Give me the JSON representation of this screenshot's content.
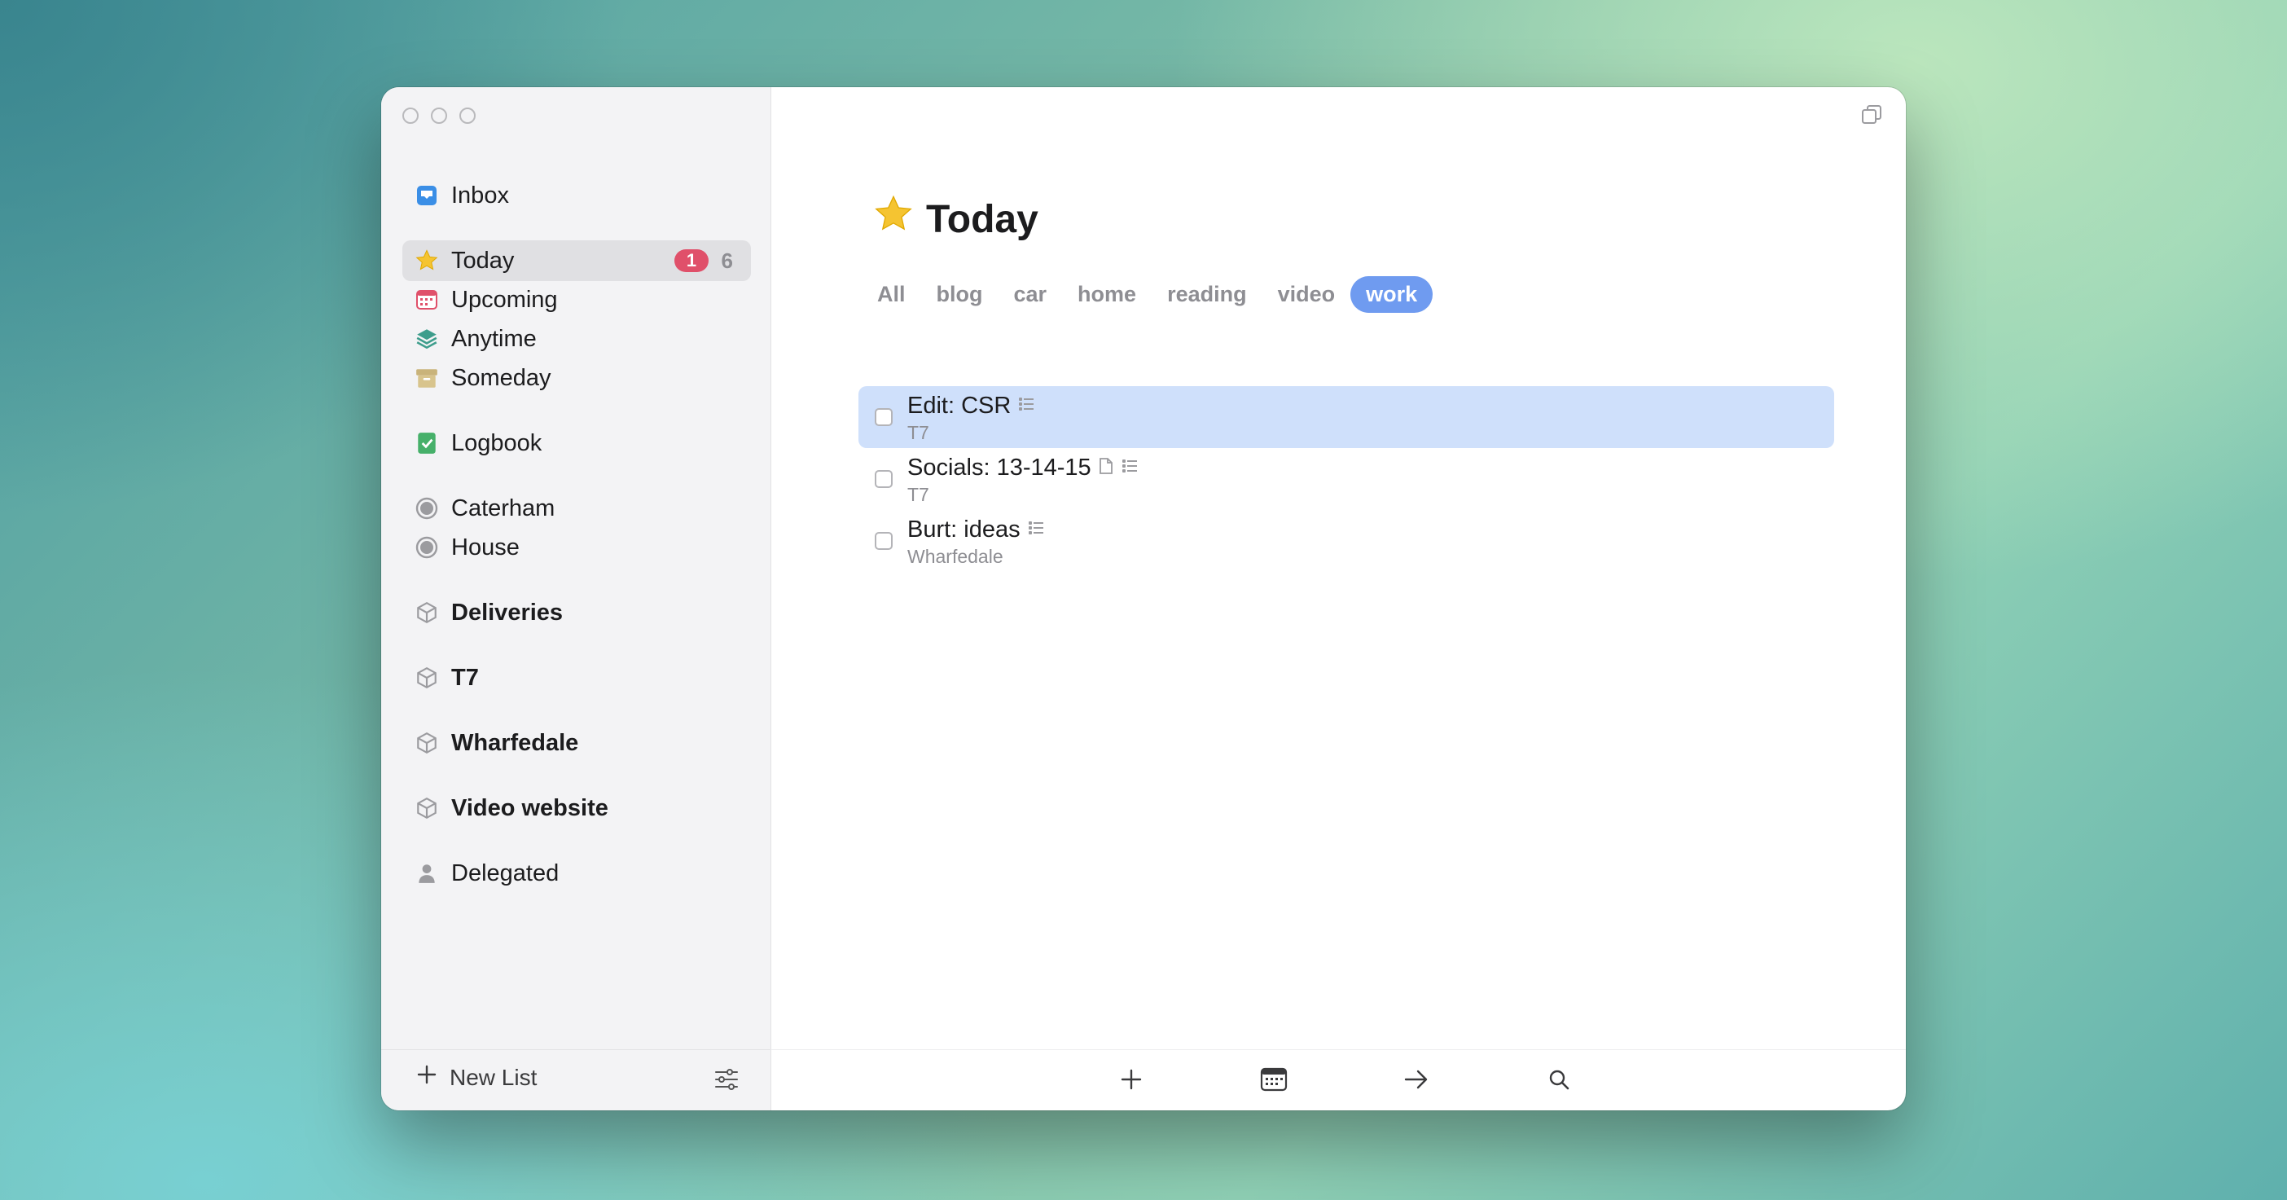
{
  "sidebar": {
    "inbox": {
      "label": "Inbox",
      "icon": "inbox-icon"
    },
    "today": {
      "label": "Today",
      "icon": "star-icon",
      "badge_due": "1",
      "count": "6"
    },
    "upcoming": {
      "label": "Upcoming",
      "icon": "calendar-icon"
    },
    "anytime": {
      "label": "Anytime",
      "icon": "layers-icon"
    },
    "someday": {
      "label": "Someday",
      "icon": "archive-box-icon"
    },
    "logbook": {
      "label": "Logbook",
      "icon": "logbook-check-icon"
    },
    "areas": [
      {
        "label": "Caterham",
        "icon": "progress-circle-icon"
      },
      {
        "label": "House",
        "icon": "progress-circle-icon"
      }
    ],
    "projects": [
      {
        "label": "Deliveries",
        "icon": "cube-icon"
      },
      {
        "label": "T7",
        "icon": "cube-icon"
      },
      {
        "label": "Wharfedale",
        "icon": "cube-icon"
      },
      {
        "label": "Video website",
        "icon": "cube-icon"
      }
    ],
    "delegated": {
      "label": "Delegated",
      "icon": "person-icon"
    },
    "footer": {
      "new_list_label": "New List"
    }
  },
  "main": {
    "title": "Today",
    "tags": [
      "All",
      "blog",
      "car",
      "home",
      "reading",
      "video",
      "work"
    ],
    "active_tag": "work",
    "tasks": [
      {
        "title": "Edit: CSR",
        "project": "T7",
        "selected": true,
        "icons": [
          "checklist-icon"
        ]
      },
      {
        "title": "Socials: 13-14-15",
        "project": "T7",
        "selected": false,
        "icons": [
          "note-icon",
          "checklist-icon"
        ]
      },
      {
        "title": "Burt: ideas",
        "project": "Wharfedale",
        "selected": false,
        "icons": [
          "checklist-icon"
        ]
      }
    ]
  },
  "colors": {
    "accent_blue": "#6f9bf0",
    "selection_blue": "#cfe0fb",
    "badge_red": "#e0506a",
    "star_yellow": "#f5c431"
  }
}
